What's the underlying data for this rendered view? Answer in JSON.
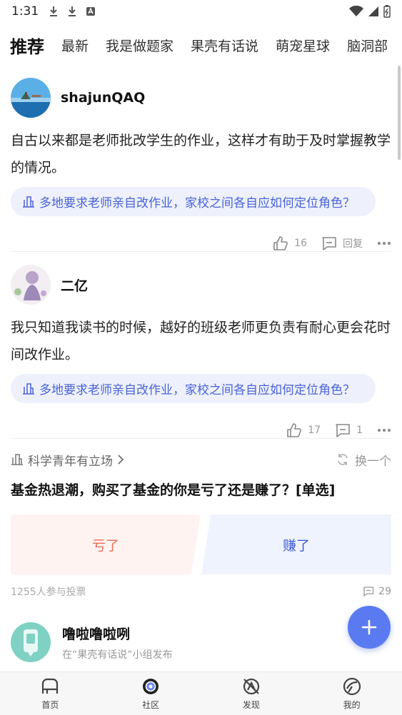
{
  "status_bar": {
    "time": "1:31"
  },
  "tabs": [
    {
      "label": "推荐",
      "active": true
    },
    {
      "label": "最新"
    },
    {
      "label": "我是做题家"
    },
    {
      "label": "果壳有话说"
    },
    {
      "label": "萌宠星球"
    },
    {
      "label": "脑洞部"
    }
  ],
  "posts": [
    {
      "username": "shajunQAQ",
      "text": "自古以来都是老师批改学生的作业，这样才有助于及时掌握教学的情况。",
      "topic": "多地要求老师亲自改作业，家校之间各自应如何定位角色？",
      "likes": "16",
      "reply_label": "回复"
    },
    {
      "username": "二亿",
      "text": "我只知道我读书的时候，越好的班级老师更负责有耐心更会花时间改作业。",
      "topic": "多地要求老师亲自改作业，家校之间各自应如何定位角色？",
      "likes": "17",
      "comments": "1"
    }
  ],
  "vote": {
    "source": "科学青年有立场",
    "refresh_label": "换一个",
    "question": "基金热退潮，购买了基金的你是亏了还是赚了？[单选]",
    "option_a": "亏了",
    "option_b": "赚了",
    "participants": "1255人参与投票",
    "comments": "29",
    "colors": {
      "option_a": "#ef6a54",
      "option_b": "#3f5ad6"
    }
  },
  "post3": {
    "username": "噜啦噜啦咧",
    "subtitle": "在“果壳有话说”小组发布"
  },
  "bottom_nav": [
    {
      "label": "首页",
      "icon": "home-icon"
    },
    {
      "label": "社区",
      "icon": "community-icon",
      "active": true
    },
    {
      "label": "发现",
      "icon": "discover-icon"
    },
    {
      "label": "我的",
      "icon": "profile-icon"
    }
  ],
  "accent_color": "#5a7af1"
}
